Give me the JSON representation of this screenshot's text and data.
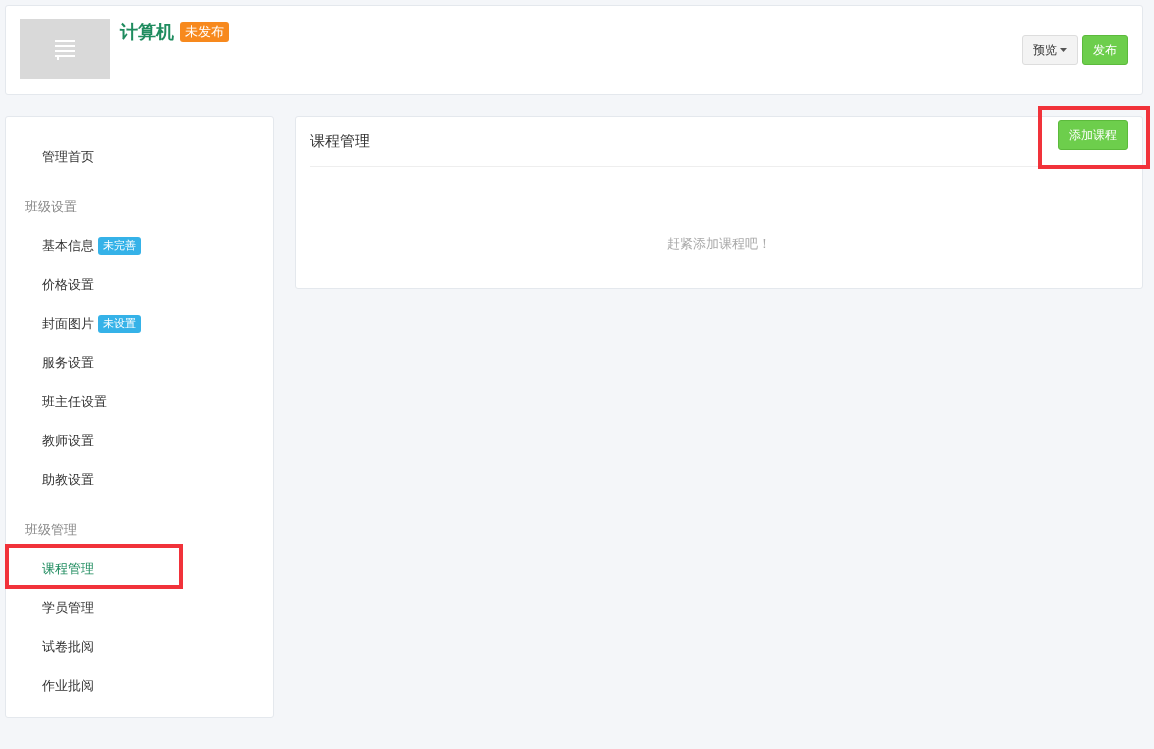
{
  "header": {
    "title": "计算机",
    "status_badge": "未发布",
    "buttons": [
      {
        "label": "预览",
        "kind": "dropdown"
      },
      {
        "label": "发布",
        "kind": "primary"
      }
    ]
  },
  "sidebar": {
    "items": [
      {
        "kind": "link",
        "label": "管理首页",
        "selected": false,
        "highlighted": false
      },
      {
        "kind": "group",
        "label": "班级设置"
      },
      {
        "kind": "link",
        "label": "基本信息",
        "badge": "未完善",
        "selected": false,
        "highlighted": false
      },
      {
        "kind": "link",
        "label": "价格设置",
        "selected": false,
        "highlighted": false
      },
      {
        "kind": "link",
        "label": "封面图片",
        "badge": "未设置",
        "selected": false,
        "highlighted": false
      },
      {
        "kind": "link",
        "label": "服务设置",
        "selected": false,
        "highlighted": false
      },
      {
        "kind": "link",
        "label": "班主任设置",
        "selected": false,
        "highlighted": false
      },
      {
        "kind": "link",
        "label": "教师设置",
        "selected": false,
        "highlighted": false
      },
      {
        "kind": "link",
        "label": "助教设置",
        "selected": false,
        "highlighted": false
      },
      {
        "kind": "group",
        "label": "班级管理"
      },
      {
        "kind": "link",
        "label": "课程管理",
        "selected": true,
        "highlighted": true
      },
      {
        "kind": "link",
        "label": "学员管理",
        "selected": false,
        "highlighted": false
      },
      {
        "kind": "link",
        "label": "试卷批阅",
        "selected": false,
        "highlighted": false
      },
      {
        "kind": "link",
        "label": "作业批阅",
        "selected": false,
        "highlighted": false
      }
    ]
  },
  "main": {
    "title": "课程管理",
    "add_button": {
      "label": "添加课程",
      "highlighted": true
    },
    "empty_message": "赶紧添加课程吧！"
  }
}
